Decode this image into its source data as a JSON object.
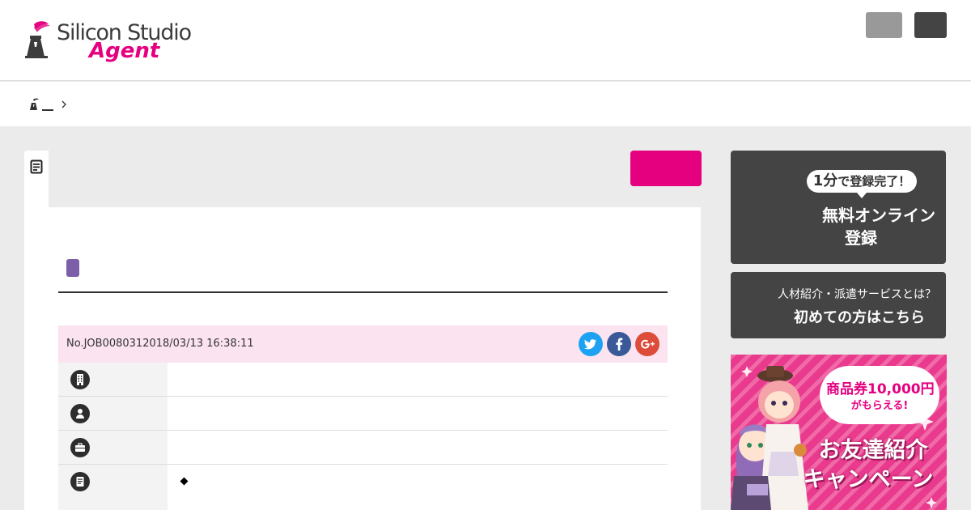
{
  "brand": {
    "name_line1": "Silicon Studio",
    "name_line2": "Agent",
    "accent": "#e5007f"
  },
  "header": {
    "buttons": [
      {
        "icon": "menu-button",
        "color": "#999999"
      },
      {
        "icon": "menu-button",
        "color": "#444444"
      }
    ]
  },
  "breadcrumb": {
    "home_icon": "home-logo-icon",
    "separator_icon": "chevron-right-icon"
  },
  "job": {
    "tab_icon": "document-icon",
    "number_and_date": "No.JOB0080312018/03/13 16:38:11",
    "share": [
      {
        "icon": "twitter-icon",
        "color": "#1da1f2"
      },
      {
        "icon": "facebook-icon",
        "color": "#3b5998"
      },
      {
        "icon": "google-plus-icon",
        "color": "#dd4b39"
      }
    ],
    "rows": [
      {
        "icon": "building-icon"
      },
      {
        "icon": "person-icon"
      },
      {
        "icon": "briefcase-icon"
      },
      {
        "icon": "document-icon",
        "bullet": "◆"
      }
    ]
  },
  "sidebar": {
    "register": {
      "bubble_strong": "1分",
      "bubble_rest": "で登録完了！",
      "line1": "無料オンライン",
      "line2": "登録"
    },
    "first_time": {
      "line1": "人材紹介・派遣サービスとは？",
      "line2": "初めての方はこちら"
    },
    "banner": {
      "prize_line1": "商品券10,000円",
      "prize_line2": "がもらえる!",
      "title_line1": "お友達紹介",
      "title_line2": "キャンペーン"
    }
  }
}
